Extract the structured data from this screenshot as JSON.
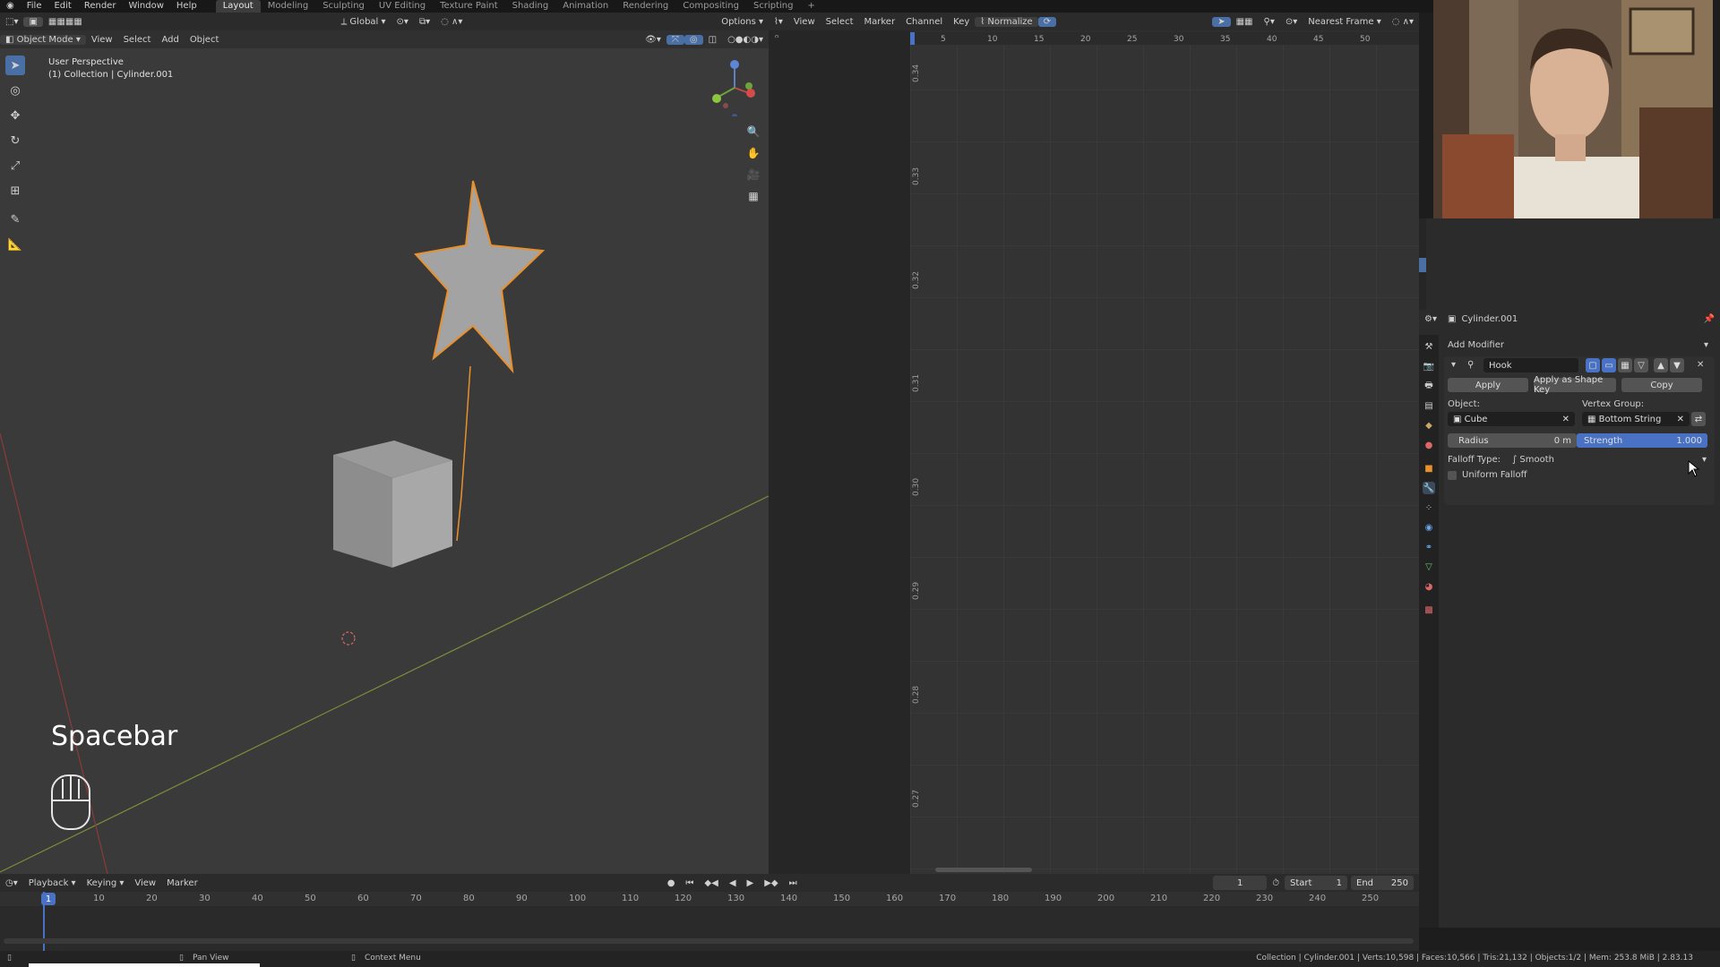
{
  "menu": [
    "File",
    "Edit",
    "Render",
    "Window",
    "Help"
  ],
  "workspaces": [
    "Layout",
    "Modeling",
    "Sculpting",
    "UV Editing",
    "Texture Paint",
    "Shading",
    "Animation",
    "Rendering",
    "Compositing",
    "Scripting",
    "+"
  ],
  "viewport": {
    "mode": "Object Mode",
    "menu": [
      "View",
      "Select",
      "Add",
      "Object"
    ],
    "transform": "Global",
    "options": "Options",
    "info_line1": "User Perspective",
    "info_line2": "(1) Collection | Cylinder.001",
    "key_overlay": "Spacebar"
  },
  "graph_editor": {
    "menu": [
      "View",
      "Select",
      "Marker",
      "Channel",
      "Key"
    ],
    "normalize": "Normalize",
    "snap": "Nearest Frame",
    "x_ticks": [
      "5",
      "10",
      "15",
      "20",
      "25",
      "30",
      "35",
      "40",
      "45",
      "50"
    ],
    "y_ticks": [
      "0.34",
      "0.33",
      "0.32",
      "0.31",
      "0.30",
      "0.29",
      "0.28",
      "0.27"
    ]
  },
  "properties": {
    "object_name": "Cylinder.001",
    "add_modifier": "Add Modifier",
    "modifier_name": "Hook",
    "apply": "Apply",
    "apply_shape": "Apply as Shape Key",
    "copy": "Copy",
    "object_label": "Object:",
    "object_value": "Cube",
    "vgroup_label": "Vertex Group:",
    "vgroup_value": "Bottom String",
    "radius_label": "Radius",
    "radius_value": "0 m",
    "strength_label": "Strength",
    "strength_value": "1.000",
    "strength_level": 1.0,
    "falloff_label": "Falloff Type:",
    "falloff_value": "Smooth",
    "uniform_falloff": "Uniform Falloff"
  },
  "timeline": {
    "menu": [
      "Playback",
      "Keying",
      "View",
      "Marker"
    ],
    "current_frame": "1",
    "start_label": "Start",
    "start_value": "1",
    "end_label": "End",
    "end_value": "250",
    "frame_ticks": [
      "1",
      "10",
      "20",
      "30",
      "40",
      "50",
      "60",
      "70",
      "80",
      "90",
      "100",
      "110",
      "120",
      "130",
      "140",
      "150",
      "160",
      "170",
      "180",
      "190",
      "200",
      "210",
      "220",
      "230",
      "240",
      "250"
    ]
  },
  "status": {
    "pan_view": "Pan View",
    "context_menu": "Context Menu",
    "stats": "Collection | Cylinder.001 | Verts:10,598 | Faces:10,566 | Tris:21,132 | Objects:1/2 | Mem: 253.8 MiB | 2.83.13"
  }
}
